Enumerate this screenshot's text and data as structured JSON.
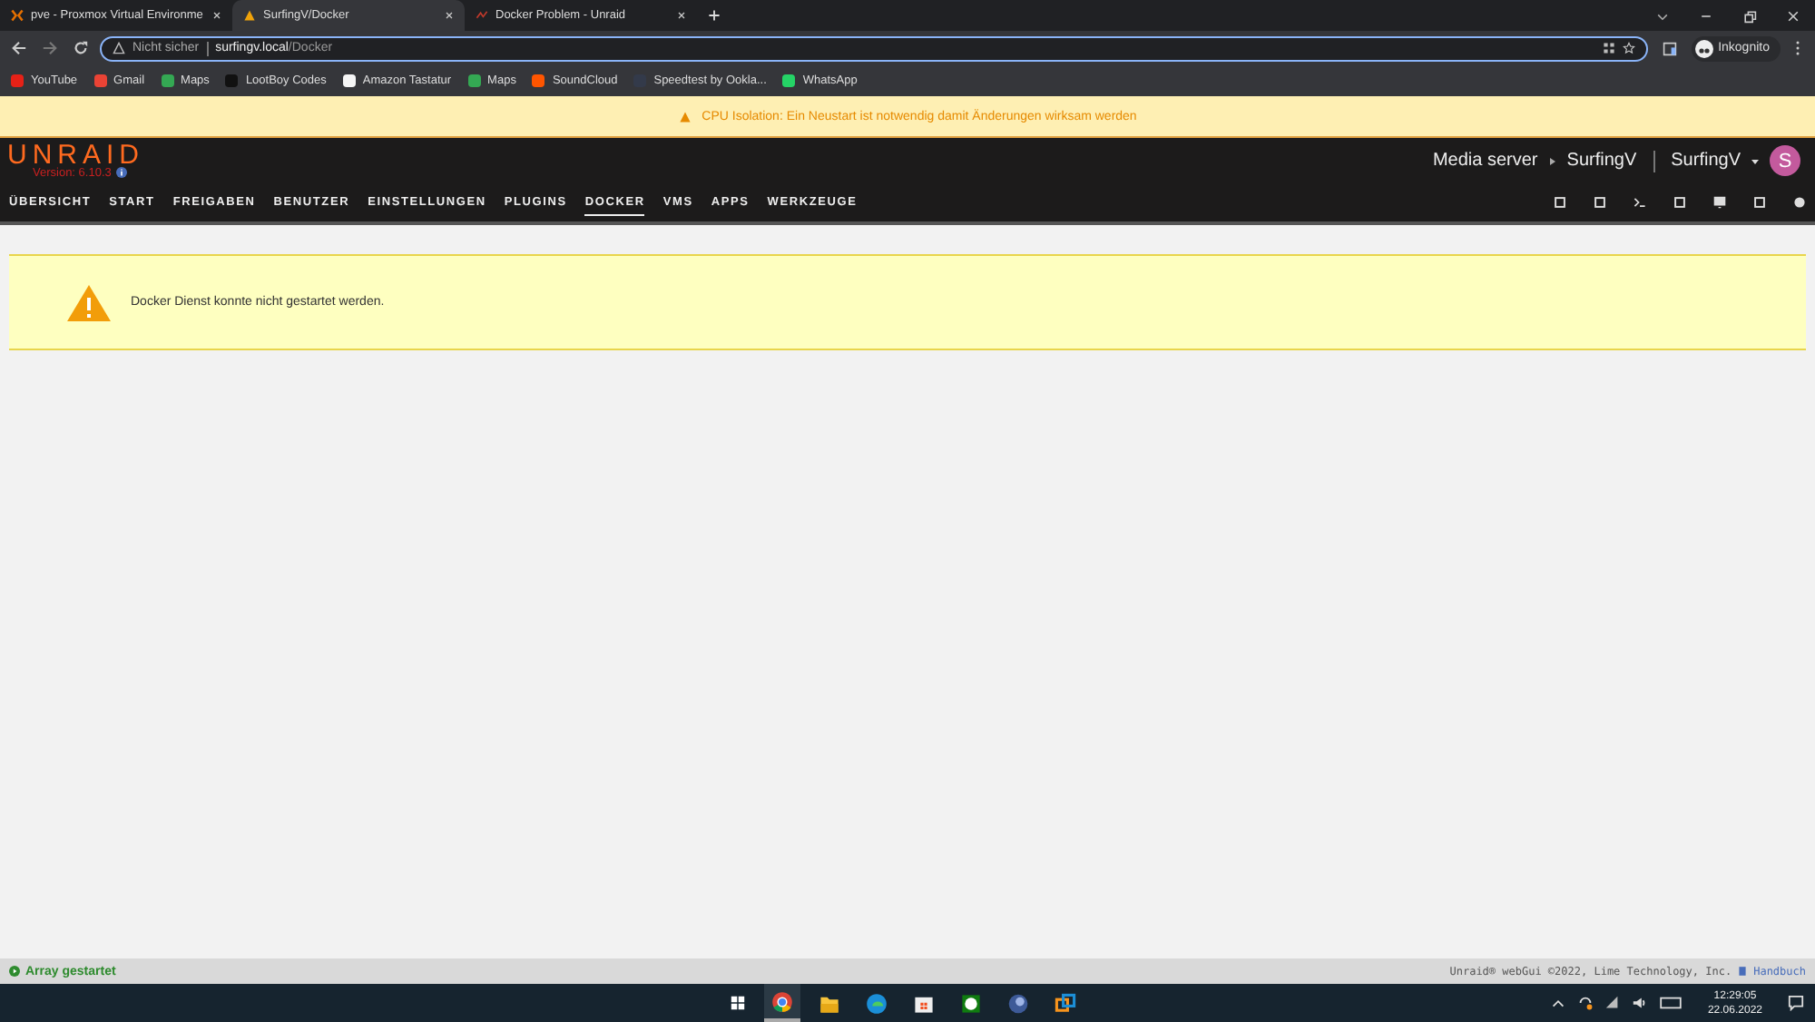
{
  "browser": {
    "tabs": [
      {
        "title": "pve - Proxmox Virtual Environme",
        "kind": "proxmox",
        "selected": false
      },
      {
        "title": "SurfingV/Docker",
        "kind": "unraid",
        "selected": true
      },
      {
        "title": "Docker Problem - Unraid",
        "kind": "forum",
        "selected": false
      }
    ],
    "security": "Nicht sicher",
    "url_host": "surfingv.local",
    "url_path": "/Docker",
    "profile": "Inkognito",
    "bookmarks": [
      {
        "label": "YouTube",
        "kind": "youtube"
      },
      {
        "label": "Gmail",
        "kind": "gmail"
      },
      {
        "label": "Maps",
        "kind": "maps"
      },
      {
        "label": "LootBoy Codes",
        "kind": "square"
      },
      {
        "label": "Amazon Tastatur",
        "kind": "amazon"
      },
      {
        "label": "Maps",
        "kind": "maps"
      },
      {
        "label": "SoundCloud",
        "kind": "soundcloud"
      },
      {
        "label": "Speedtest by Ookla...",
        "kind": "speedtest"
      },
      {
        "label": "WhatsApp",
        "kind": "whatsapp"
      }
    ]
  },
  "notice": "CPU Isolation: Ein Neustart ist notwendig damit Änderungen wirksam werden",
  "header": {
    "logo": "UNRAID",
    "version": "Version: 6.10.3",
    "server_description": "Media server",
    "server_name": "SurfingV",
    "user": "SurfingV",
    "avatar_letter": "S"
  },
  "nav": [
    {
      "label": "ÜBERSICHT",
      "selected": false
    },
    {
      "label": "START",
      "selected": false
    },
    {
      "label": "FREIGABEN",
      "selected": false
    },
    {
      "label": "BENUTZER",
      "selected": false
    },
    {
      "label": "EINSTELLUNGEN",
      "selected": false
    },
    {
      "label": "PLUGINS",
      "selected": false
    },
    {
      "label": "DOCKER",
      "selected": true
    },
    {
      "label": "VMS",
      "selected": false
    },
    {
      "label": "APPS",
      "selected": false
    },
    {
      "label": "WERKZEUGE",
      "selected": false
    }
  ],
  "warning": "Docker Dienst konnte nicht gestartet werden.",
  "status_bar": {
    "array_status": "Array gestartet",
    "copyright": "Unraid® webGui ©2022, Lime Technology, Inc.",
    "manual_link": "Handbuch"
  },
  "taskbar": {
    "apps": [
      {
        "kind": "chrome",
        "selected": true
      },
      {
        "kind": "explorer",
        "selected": false
      },
      {
        "kind": "edge",
        "selected": false
      },
      {
        "kind": "store",
        "selected": false
      },
      {
        "kind": "xbox",
        "selected": false
      },
      {
        "kind": "orb",
        "selected": false
      },
      {
        "kind": "vmware",
        "selected": false
      }
    ],
    "time": "12:29:05",
    "date": "22.06.2022"
  }
}
